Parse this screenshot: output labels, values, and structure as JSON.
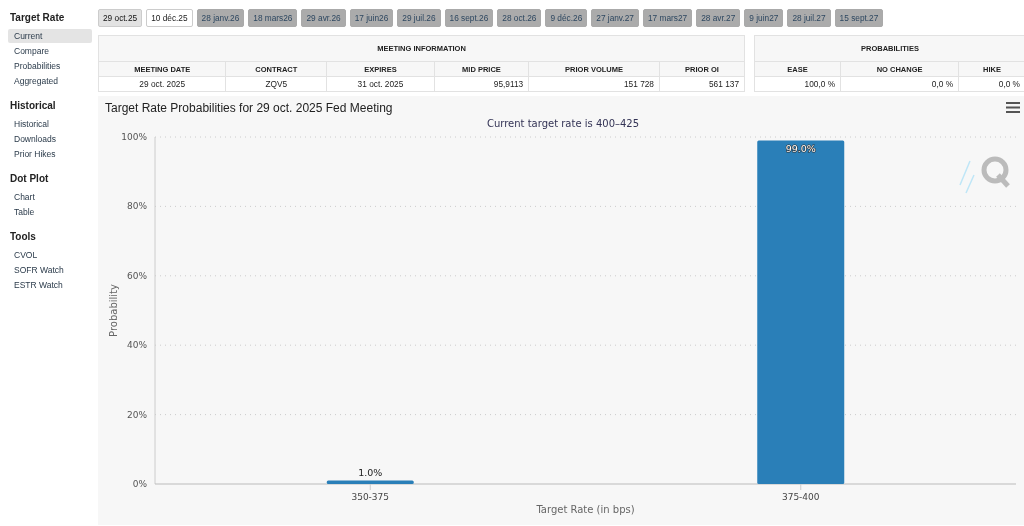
{
  "sidebar": {
    "sections": [
      {
        "title": "Target Rate",
        "items": [
          {
            "label": "Current",
            "selected": true
          },
          {
            "label": "Compare",
            "selected": false
          },
          {
            "label": "Probabilities",
            "selected": false
          },
          {
            "label": "Aggregated",
            "selected": false
          }
        ]
      },
      {
        "title": "Historical",
        "items": [
          {
            "label": "Historical",
            "selected": false
          },
          {
            "label": "Downloads",
            "selected": false
          },
          {
            "label": "Prior Hikes",
            "selected": false
          }
        ]
      },
      {
        "title": "Dot Plot",
        "items": [
          {
            "label": "Chart",
            "selected": false
          },
          {
            "label": "Table",
            "selected": false
          }
        ]
      },
      {
        "title": "Tools",
        "items": [
          {
            "label": "CVOL",
            "selected": false
          },
          {
            "label": "SOFR Watch",
            "selected": false
          },
          {
            "label": "ESTR Watch",
            "selected": false
          }
        ]
      }
    ]
  },
  "date_tabs": [
    {
      "label": "29 oct.25",
      "kind": "near",
      "selected": true
    },
    {
      "label": "10 déc.25",
      "kind": "near",
      "selected": false
    },
    {
      "label": "28 janv.26",
      "kind": "far",
      "selected": false
    },
    {
      "label": "18 mars26",
      "kind": "far",
      "selected": false
    },
    {
      "label": "29 avr.26",
      "kind": "far",
      "selected": false
    },
    {
      "label": "17 juin26",
      "kind": "far",
      "selected": false
    },
    {
      "label": "29 juil.26",
      "kind": "far",
      "selected": false
    },
    {
      "label": "16 sept.26",
      "kind": "far",
      "selected": false
    },
    {
      "label": "28 oct.26",
      "kind": "far",
      "selected": false
    },
    {
      "label": "9 déc.26",
      "kind": "far",
      "selected": false
    },
    {
      "label": "27 janv.27",
      "kind": "far",
      "selected": false
    },
    {
      "label": "17 mars27",
      "kind": "far",
      "selected": false
    },
    {
      "label": "28 avr.27",
      "kind": "far",
      "selected": false
    },
    {
      "label": "9 juin27",
      "kind": "far",
      "selected": false
    },
    {
      "label": "28 juil.27",
      "kind": "far",
      "selected": false
    },
    {
      "label": "15 sept.27",
      "kind": "far",
      "selected": false
    }
  ],
  "tables": [
    {
      "title": "MEETING INFORMATION",
      "columns": [
        {
          "label": "MEETING DATE",
          "kind": "text"
        },
        {
          "label": "CONTRACT",
          "kind": "text"
        },
        {
          "label": "EXPIRES",
          "kind": "text"
        },
        {
          "label": "MID PRICE",
          "kind": "number"
        },
        {
          "label": "PRIOR VOLUME",
          "kind": "number"
        },
        {
          "label": "PRIOR OI",
          "kind": "number"
        }
      ],
      "rows": [
        [
          "29 oct. 2025",
          "ZQV5",
          "31 oct. 2025",
          "95,9113",
          "151 728",
          "561 137"
        ]
      ]
    },
    {
      "title": "PROBABILITIES",
      "columns": [
        {
          "label": "EASE",
          "kind": "number"
        },
        {
          "label": "NO CHANGE",
          "kind": "number"
        },
        {
          "label": "HIKE",
          "kind": "number"
        }
      ],
      "rows": [
        [
          "100,0 %",
          "0,0 %",
          "0,0 %"
        ]
      ]
    }
  ],
  "chart": {
    "title": "Target Rate Probabilities for 29 oct. 2025 Fed Meeting",
    "subtitle": "Current target rate is 400–425",
    "chart_data": {
      "type": "bar",
      "xlabel": "Target Rate (in bps)",
      "ylabel": "Probability",
      "categories": [
        "350-375",
        "375-400"
      ],
      "series": [
        {
          "color": "#2a7fb8",
          "values": [
            1.0,
            99.0
          ]
        }
      ],
      "grid": true,
      "ylim": [
        0,
        100
      ],
      "yticks": [
        {
          "value": 0,
          "label": "0%"
        },
        {
          "value": 20,
          "label": "20%"
        },
        {
          "value": 40,
          "label": "40%"
        },
        {
          "value": 60,
          "label": "60%"
        },
        {
          "value": 80,
          "label": "80%"
        },
        {
          "value": 100,
          "label": "100%"
        }
      ],
      "value_labels": [
        "1.0%",
        "99.0%"
      ]
    }
  }
}
